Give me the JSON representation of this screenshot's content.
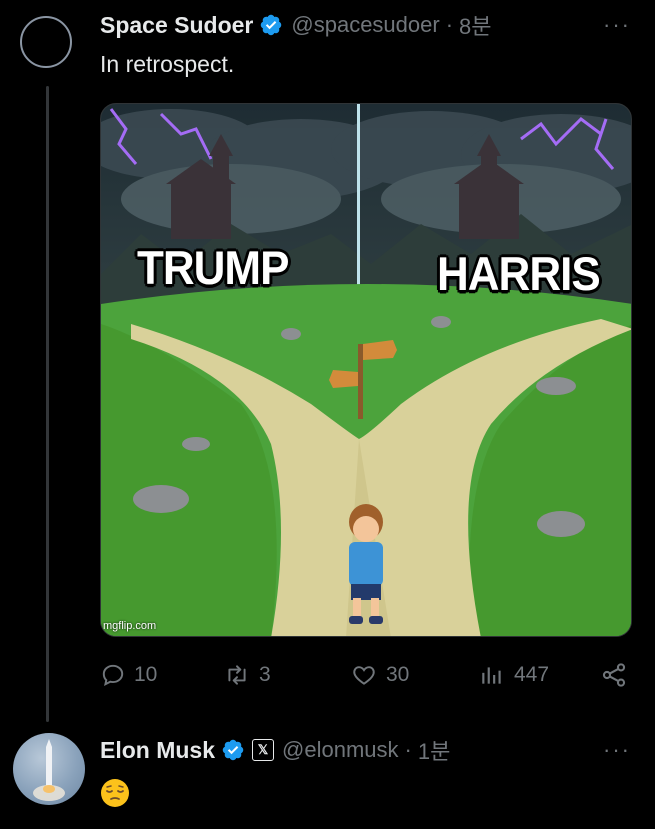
{
  "tweet": {
    "author_name": "Space Sudoer",
    "handle": "@spacesudoer",
    "separator": "·",
    "time": "8분",
    "text": "In retrospect.",
    "more": "···",
    "media": {
      "left_label": "TRUMP",
      "right_label": "HARRIS",
      "watermark": "mgflip.com"
    },
    "actions": {
      "replies": "10",
      "reposts": "3",
      "likes": "30",
      "views": "447"
    }
  },
  "reply": {
    "author_name": "Elon Musk",
    "affiliate_badge": "𝕏",
    "handle": "@elonmusk",
    "separator": "·",
    "time": "1분",
    "more": "···",
    "emoji": "pensive-face"
  },
  "colors": {
    "background": "#000000",
    "text_primary": "#e7e9ea",
    "text_secondary": "#71767b",
    "verified_blue": "#1d9bf0"
  }
}
